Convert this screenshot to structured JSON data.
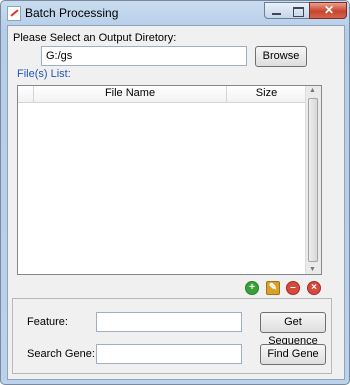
{
  "window": {
    "title": "Batch Processing",
    "controls": {
      "minimize": "",
      "maximize": "",
      "close": "✕"
    }
  },
  "output": {
    "label": "Please Select an Output Diretory:",
    "path": "G:/gs",
    "browse_label": "Browse"
  },
  "files": {
    "label": "File(s) List:",
    "columns": [
      "File Name",
      "Size"
    ],
    "rows": []
  },
  "toolbar": {
    "add": "+",
    "edit": "✎",
    "remove": "–",
    "delete": "×"
  },
  "search": {
    "feature_label": "Feature:",
    "feature_value": "",
    "get_sequence_label": "Get Sequence",
    "gene_label": "Search Gene:",
    "gene_value": "",
    "find_gene_label": "Find Gene"
  },
  "colors": {
    "title_gradient": "#c9dcf1",
    "list_label": "#2254b8",
    "close_button": "#c7452e"
  }
}
